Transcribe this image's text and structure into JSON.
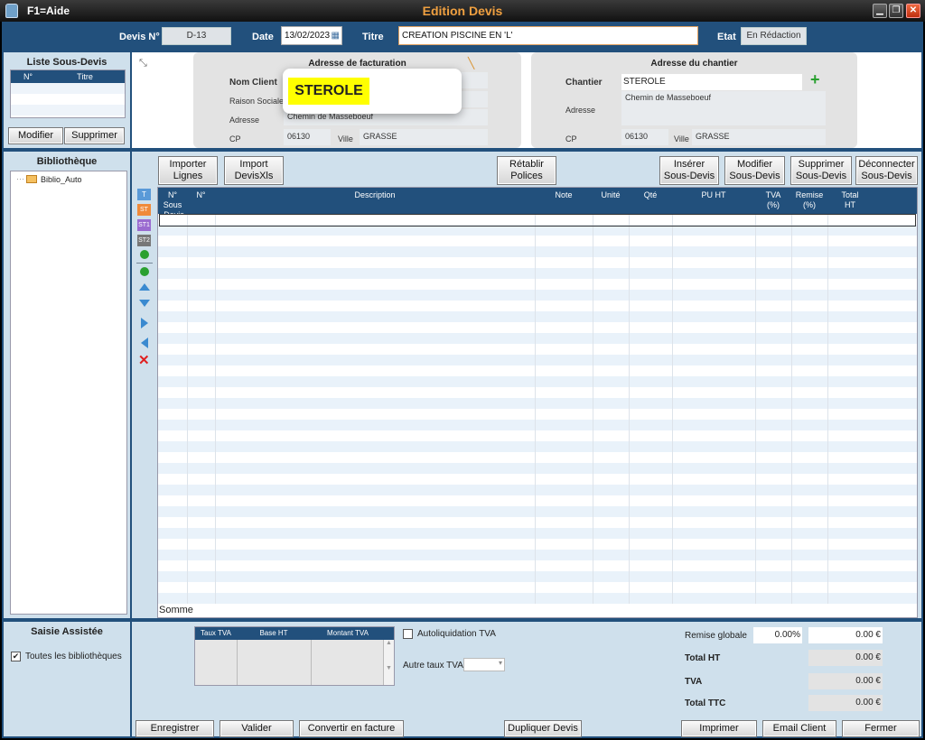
{
  "window": {
    "help": "F1=Aide",
    "title": "Edition Devis"
  },
  "header": {
    "devis_label": "Devis N°",
    "devis_value": "D-13",
    "date_label": "Date",
    "date_value": "13/02/2023",
    "titre_label": "Titre",
    "titre_value": "CREATION PISCINE EN 'L'",
    "etat_label": "Etat",
    "etat_value": "En Rédaction"
  },
  "sous_devis": {
    "title": "Liste Sous-Devis",
    "col_n": "N°",
    "col_titre": "Titre",
    "modifier": "Modifier",
    "supprimer": "Supprimer"
  },
  "biblio": {
    "title": "Bibliothèque",
    "item": "Biblio_Auto"
  },
  "facturation": {
    "title": "Adresse de facturation",
    "nom_label": "Nom Client",
    "raison_label": "Raison Sociale",
    "adresse_label": "Adresse",
    "adresse_value": "Chemin de Masseboeuf",
    "cp_label": "CP",
    "cp_value": "06130",
    "ville_label": "Ville",
    "ville_value": "GRASSE",
    "popup": "STEROLE"
  },
  "chantier": {
    "title": "Adresse du chantier",
    "chantier_label": "Chantier",
    "chantier_value": "STEROLE",
    "adresse_label": "Adresse",
    "adresse_value": "Chemin de Masseboeuf",
    "cp_label": "CP",
    "cp_value": "06130",
    "ville_label": "Ville",
    "ville_value": "GRASSE"
  },
  "toolbar": {
    "importer": [
      "Importer",
      "Lignes"
    ],
    "import_xls": [
      "Import",
      "DevisXls"
    ],
    "retablir": [
      "Rétablir",
      "Polices"
    ],
    "inserer": [
      "Insérer",
      "Sous-Devis"
    ],
    "modifier": [
      "Modifier",
      "Sous-Devis"
    ],
    "supprimer": [
      "Supprimer",
      "Sous-Devis"
    ],
    "deconnecter": [
      "Déconnecter",
      "Sous-Devis"
    ]
  },
  "table": {
    "cols": [
      [
        "N° Sous",
        "-Devis"
      ],
      [
        "N°",
        ""
      ],
      [
        "Description",
        ""
      ],
      [
        "Note",
        ""
      ],
      [
        "Unité",
        ""
      ],
      [
        "Qté",
        ""
      ],
      [
        "PU HT",
        ""
      ],
      [
        "TVA",
        "(%)"
      ],
      [
        "Remise",
        "(%)"
      ],
      [
        "Total",
        "HT"
      ]
    ],
    "somme": "Somme"
  },
  "saisie": {
    "title": "Saisie Assistée",
    "checkbox": "Toutes les bibliothèques"
  },
  "tva": {
    "col_taux": "Taux TVA",
    "col_base": "Base HT",
    "col_montant": "Montant TVA",
    "autoliquidation": "Autoliquidation TVA",
    "autre_taux": "Autre taux TVA"
  },
  "totals": {
    "remise_label": "Remise globale",
    "remise_pct": "0.00%",
    "remise_val": "0.00 €",
    "ht_label": "Total HT",
    "ht_val": "0.00 €",
    "tva_label": "TVA",
    "tva_val": "0.00 €",
    "ttc_label": "Total TTC",
    "ttc_val": "0.00 €"
  },
  "footer": {
    "enregistrer": "Enregistrer",
    "valider": "Valider",
    "convertir": "Convertir en facture",
    "dupliquer": "Dupliquer Devis",
    "imprimer": "Imprimer",
    "email": "Email Client",
    "fermer": "Fermer"
  },
  "colors": {
    "navy": "#22507c",
    "panel": "#cfe0ec",
    "accent": "#f0a040",
    "popup": "#ffff00"
  }
}
